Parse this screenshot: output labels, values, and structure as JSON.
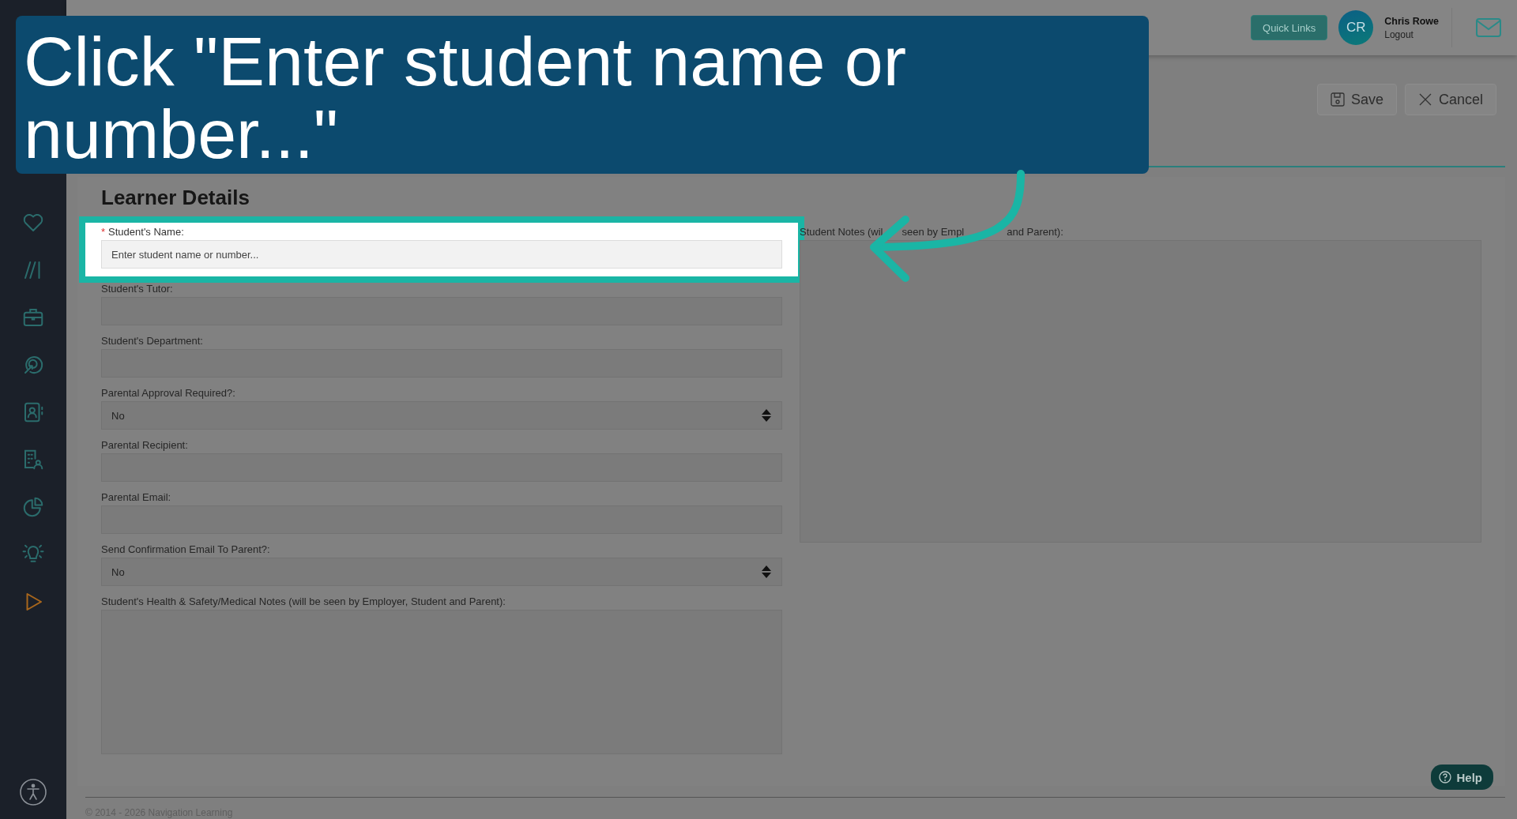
{
  "callout": {
    "text": "Click \"Enter student name or number...\""
  },
  "header": {
    "quick_links": "Quick Links",
    "avatar": "CR",
    "user_name": "Chris Rowe",
    "logout": "Logout"
  },
  "sidebar": {
    "items": [
      {
        "kind": "heart"
      },
      {
        "kind": "slashes"
      },
      {
        "kind": "briefcase"
      },
      {
        "kind": "target"
      },
      {
        "kind": "contacts"
      },
      {
        "kind": "building"
      },
      {
        "kind": "pie"
      },
      {
        "kind": "bulb"
      },
      {
        "kind": "play"
      }
    ]
  },
  "toolbar": {
    "buttons": [
      {
        "label": "Save",
        "kind": "save"
      },
      {
        "label": "Cancel",
        "kind": "cancel"
      }
    ]
  },
  "section_title": "Learner Details",
  "fields": [
    {
      "label": "Student's Name:",
      "required_mark": "*",
      "kind": "text",
      "placeholder": "Enter student name or number...",
      "highlighted": true
    },
    {
      "label": "Student's Tutor:",
      "kind": "text",
      "highlighted": false
    },
    {
      "label": "Student's Department:",
      "kind": "text",
      "highlighted": false
    },
    {
      "label": "Parental Approval Required?:",
      "kind": "select",
      "value": "No",
      "highlighted": false
    },
    {
      "label": "Parental Recipient:",
      "kind": "text",
      "highlighted": false
    },
    {
      "label": "Parental Email:",
      "kind": "text",
      "highlighted": false
    },
    {
      "label": "Send Confirmation Email To Parent?:",
      "kind": "select",
      "value": "No",
      "highlighted": false
    },
    {
      "label": "Student's Health & Safety/Medical Notes (will be seen by Employer, Student and Parent):",
      "kind": "textarea",
      "highlighted": false
    }
  ],
  "notes": {
    "label_parts": [
      "Student Notes (wil",
      "seen by Empl",
      "and Parent):"
    ]
  },
  "help": "Help",
  "footer": "© 2014 - 2026 Navigation Learning"
}
